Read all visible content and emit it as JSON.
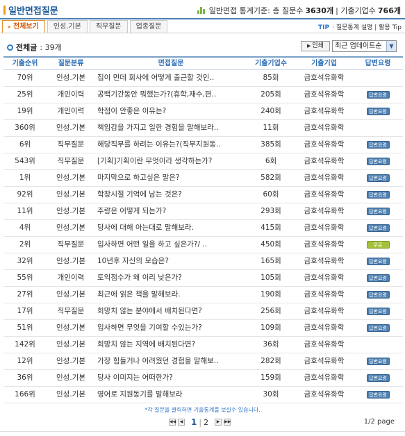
{
  "header": {
    "title": "일반면접질문",
    "stats_prefix": "일반면접 통계기준: 총 질문수",
    "total_questions": "3630개",
    "stats_sep": "| 기출기업수",
    "total_companies": "766개"
  },
  "tabs": [
    {
      "label": "전체보기",
      "active": true
    },
    {
      "label": "인성.기본",
      "active": false
    },
    {
      "label": "직무질문",
      "active": false
    },
    {
      "label": "업종질문",
      "active": false
    }
  ],
  "tip": {
    "label": "TIP",
    "text": "· 질문통계 설명 | 활용 Tip"
  },
  "summary": {
    "label": "전체글",
    "count": ": 39개"
  },
  "print_label": "인쇄",
  "sort": {
    "selected": "최근 업데이트순"
  },
  "table": {
    "headers": [
      "기출순위",
      "질문분류",
      "면접질문",
      "기출기업수",
      "기출기업",
      "답변요령"
    ],
    "rows": [
      {
        "rank": "70위",
        "category": "인성.기본",
        "question": "집이 먼데 회사에 어떻게 출근할 것인..",
        "count": "85회",
        "company": "금호석유화학",
        "answer": ""
      },
      {
        "rank": "25위",
        "category": "개인이력",
        "question": "공백기간동안 뭐했는가?(휴학,재수,편..",
        "count": "205회",
        "company": "금호석유화학",
        "answer": "답변요령"
      },
      {
        "rank": "19위",
        "category": "개인이력",
        "question": "학점이 안좋은 이유는?",
        "count": "240회",
        "company": "금호석유화학",
        "answer": "답변요령"
      },
      {
        "rank": "360위",
        "category": "인성.기본",
        "question": "책임감을 가지고 일한 경험을 말해보라..",
        "count": "11회",
        "company": "금호석유화학",
        "answer": ""
      },
      {
        "rank": "6위",
        "category": "직무질문",
        "question": "해당직무를 하려는 이유는?(직무지원동..",
        "count": "385회",
        "company": "금호석유화학",
        "answer": "답변요령"
      },
      {
        "rank": "543위",
        "category": "직무질문",
        "question": "[기획]기획이란 무엇이라 생각하는가?",
        "count": "6회",
        "company": "금호석유화학",
        "answer": "답변요령"
      },
      {
        "rank": "1위",
        "category": "인성.기본",
        "question": "마지막으로 하고싶은 말은?",
        "count": "582회",
        "company": "금호석유화학",
        "answer": "답변요령"
      },
      {
        "rank": "92위",
        "category": "인성.기본",
        "question": "학창시절 기억에 남는 것은?",
        "count": "60회",
        "company": "금호석유화학",
        "answer": "답변요령"
      },
      {
        "rank": "11위",
        "category": "인성.기본",
        "question": "주량은 어떻게 되는가?",
        "count": "293회",
        "company": "금호석유화학",
        "answer": "답변요령"
      },
      {
        "rank": "4위",
        "category": "인성.기본",
        "question": "당사에 대해 아는대로 말해보라.",
        "count": "415회",
        "company": "금호석유화학",
        "answer": "답변요령"
      },
      {
        "rank": "2위",
        "category": "직무질문",
        "question": "입사하면 어떤 일을 하고 싶은가?/ ..",
        "count": "450회",
        "company": "금호석유화학",
        "answer": "무료"
      },
      {
        "rank": "32위",
        "category": "인성.기본",
        "question": "10년후 자신의 모습은?",
        "count": "165회",
        "company": "금호석유화학",
        "answer": "답변요령"
      },
      {
        "rank": "55위",
        "category": "개인이력",
        "question": "토익점수가 왜 이리 낮은가?",
        "count": "105회",
        "company": "금호석유화학",
        "answer": "답변요령"
      },
      {
        "rank": "27위",
        "category": "인성.기본",
        "question": "최근에 읽은 책을 말해보라.",
        "count": "190회",
        "company": "금호석유화학",
        "answer": "답변요령"
      },
      {
        "rank": "17위",
        "category": "직무질문",
        "question": "희망치 않는 분야에서 배치된다면?",
        "count": "256회",
        "company": "금호석유화학",
        "answer": "답변요령"
      },
      {
        "rank": "51위",
        "category": "인성.기본",
        "question": "입사하면 무엇을 기여할 수있는가?",
        "count": "109회",
        "company": "금호석유화학",
        "answer": "답변요령"
      },
      {
        "rank": "142위",
        "category": "인성.기본",
        "question": "희망치 않는 지역에 배치된다면?",
        "count": "36회",
        "company": "금호석유화학",
        "answer": ""
      },
      {
        "rank": "12위",
        "category": "인성.기본",
        "question": "가장 힘들거나 어려웠던 경험을 말해보..",
        "count": "282회",
        "company": "금호석유화학",
        "answer": "답변요령"
      },
      {
        "rank": "36위",
        "category": "인성.기본",
        "question": "당사 이미지는 어떠한가?",
        "count": "159회",
        "company": "금호석유화학",
        "answer": "답변요령"
      },
      {
        "rank": "166위",
        "category": "인성.기본",
        "question": "영어로 지원동기를 말해보라",
        "count": "30회",
        "company": "금호석유화학",
        "answer": "답변요령"
      }
    ]
  },
  "note": "*각 질문을 클릭하면 기출통계를 보실수 있습니다.",
  "pagination": {
    "current": "1",
    "separator": "|",
    "next": "2",
    "info": "1/2 page"
  },
  "colors": {
    "accent_blue": "#2f76c6",
    "answer_blue": "#4d7fb0",
    "answer_green": "#a3c23a",
    "tab_active": "#e2902a"
  }
}
